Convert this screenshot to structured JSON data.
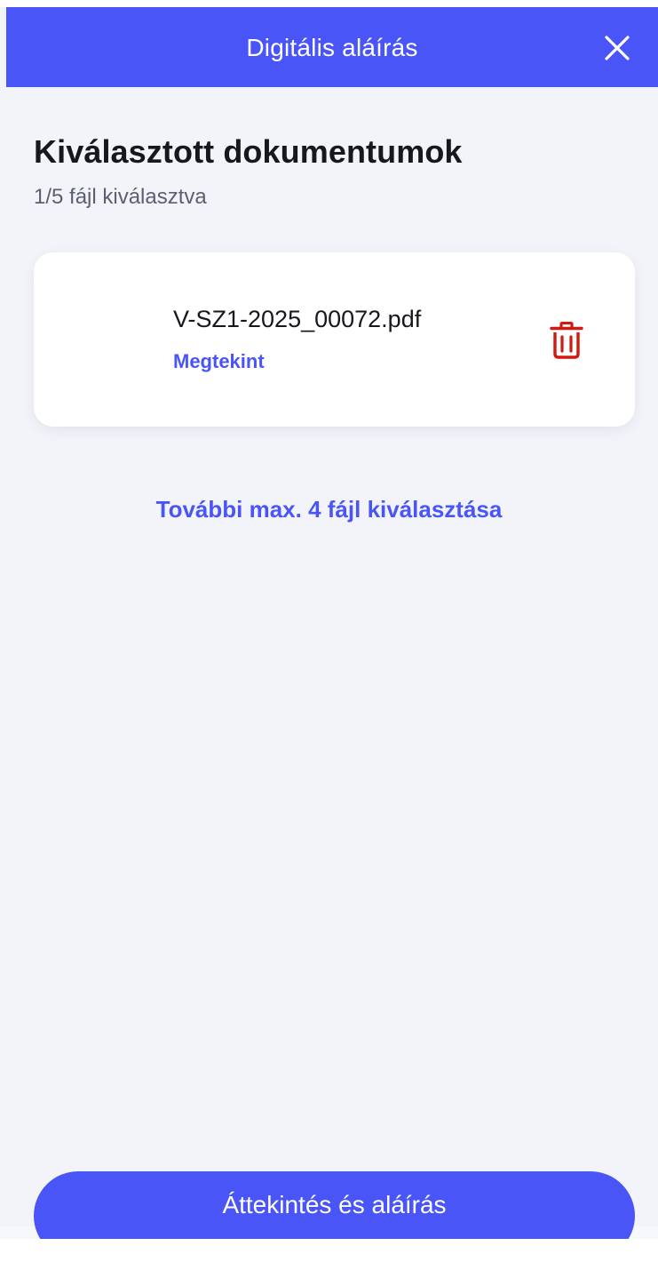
{
  "header": {
    "title": "Digitális aláírás",
    "close_icon": "close-icon"
  },
  "main": {
    "title": "Kiválasztott dokumentumok",
    "subtitle": "1/5 fájl kiválasztva",
    "files": [
      {
        "name": "V-SZ1-2025_00072.pdf",
        "view_label": "Megtekint",
        "delete_icon": "trash-icon"
      }
    ],
    "add_more_label": "További max. 4 fájl kiválasztása"
  },
  "footer": {
    "primary_label": "Áttekintés és aláírás"
  },
  "colors": {
    "accent": "#4a55f7",
    "danger": "#d0190f",
    "background": "#f2f4f9",
    "text_primary": "#16181d",
    "text_secondary": "#5b6070"
  }
}
